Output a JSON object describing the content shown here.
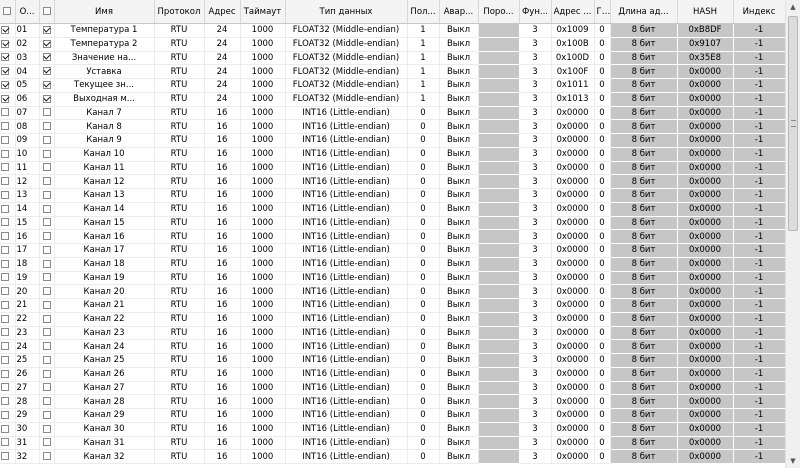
{
  "header": {
    "check_label": "",
    "number": "О...",
    "enabled": "",
    "name": "Имя",
    "protocol": "Протокол",
    "address": "Адрес",
    "timeout": "Таймаут",
    "datatype": "Тип данных",
    "pol": "Пол...",
    "alarm": "Авар...",
    "threshold": "Поро...",
    "func": "Фун...",
    "regaddr": "Адрес ...",
    "g": "Г...",
    "len": "Длина ад...",
    "hash": "HASH",
    "index": "Индекс"
  },
  "rows": [
    {
      "c1": true,
      "num": "01",
      "c2": true,
      "name": "Температура 1",
      "protocol": "RTU",
      "address": "24",
      "timeout": "1000",
      "datatype": "FLOAT32 (Middle-endian)",
      "pol": "1",
      "alarm": "Выкл",
      "func": "3",
      "regaddr": "0x1009",
      "g": "0",
      "len": "8 бит",
      "hash": "0xB8DF",
      "index": "-1"
    },
    {
      "c1": true,
      "num": "02",
      "c2": true,
      "name": "Температура 2",
      "protocol": "RTU",
      "address": "24",
      "timeout": "1000",
      "datatype": "FLOAT32 (Middle-endian)",
      "pol": "1",
      "alarm": "Выкл",
      "func": "3",
      "regaddr": "0x100B",
      "g": "0",
      "len": "8 бит",
      "hash": "0x9107",
      "index": "-1"
    },
    {
      "c1": true,
      "num": "03",
      "c2": true,
      "name": "Значение на...",
      "protocol": "RTU",
      "address": "24",
      "timeout": "1000",
      "datatype": "FLOAT32 (Middle-endian)",
      "pol": "1",
      "alarm": "Выкл",
      "func": "3",
      "regaddr": "0x100D",
      "g": "0",
      "len": "8 бит",
      "hash": "0x35E8",
      "index": "-1"
    },
    {
      "c1": true,
      "num": "04",
      "c2": true,
      "name": "Уставка",
      "protocol": "RTU",
      "address": "24",
      "timeout": "1000",
      "datatype": "FLOAT32 (Middle-endian)",
      "pol": "1",
      "alarm": "Выкл",
      "func": "3",
      "regaddr": "0x100F",
      "g": "0",
      "len": "8 бит",
      "hash": "0x0000",
      "index": "-1"
    },
    {
      "c1": true,
      "num": "05",
      "c2": true,
      "name": "Текущее зн...",
      "protocol": "RTU",
      "address": "24",
      "timeout": "1000",
      "datatype": "FLOAT32 (Middle-endian)",
      "pol": "1",
      "alarm": "Выкл",
      "func": "3",
      "regaddr": "0x1011",
      "g": "0",
      "len": "8 бит",
      "hash": "0x0000",
      "index": "-1"
    },
    {
      "c1": true,
      "num": "06",
      "c2": true,
      "name": "Выходная м...",
      "protocol": "RTU",
      "address": "24",
      "timeout": "1000",
      "datatype": "FLOAT32 (Middle-endian)",
      "pol": "1",
      "alarm": "Выкл",
      "func": "3",
      "regaddr": "0x1013",
      "g": "0",
      "len": "8 бит",
      "hash": "0x0000",
      "index": "-1"
    },
    {
      "c1": false,
      "num": "07",
      "c2": false,
      "name": "Канал 7",
      "protocol": "RTU",
      "address": "16",
      "timeout": "1000",
      "datatype": "INT16 (Little-endian)",
      "pol": "0",
      "alarm": "Выкл",
      "func": "3",
      "regaddr": "0x0000",
      "g": "0",
      "len": "8 бит",
      "hash": "0x0000",
      "index": "-1"
    },
    {
      "c1": false,
      "num": "08",
      "c2": false,
      "name": "Канал 8",
      "protocol": "RTU",
      "address": "16",
      "timeout": "1000",
      "datatype": "INT16 (Little-endian)",
      "pol": "0",
      "alarm": "Выкл",
      "func": "3",
      "regaddr": "0x0000",
      "g": "0",
      "len": "8 бит",
      "hash": "0x0000",
      "index": "-1"
    },
    {
      "c1": false,
      "num": "09",
      "c2": false,
      "name": "Канал 9",
      "protocol": "RTU",
      "address": "16",
      "timeout": "1000",
      "datatype": "INT16 (Little-endian)",
      "pol": "0",
      "alarm": "Выкл",
      "func": "3",
      "regaddr": "0x0000",
      "g": "0",
      "len": "8 бит",
      "hash": "0x0000",
      "index": "-1"
    },
    {
      "c1": false,
      "num": "10",
      "c2": false,
      "name": "Канал 10",
      "protocol": "RTU",
      "address": "16",
      "timeout": "1000",
      "datatype": "INT16 (Little-endian)",
      "pol": "0",
      "alarm": "Выкл",
      "func": "3",
      "regaddr": "0x0000",
      "g": "0",
      "len": "8 бит",
      "hash": "0x0000",
      "index": "-1"
    },
    {
      "c1": false,
      "num": "11",
      "c2": false,
      "name": "Канал 11",
      "protocol": "RTU",
      "address": "16",
      "timeout": "1000",
      "datatype": "INT16 (Little-endian)",
      "pol": "0",
      "alarm": "Выкл",
      "func": "3",
      "regaddr": "0x0000",
      "g": "0",
      "len": "8 бит",
      "hash": "0x0000",
      "index": "-1"
    },
    {
      "c1": false,
      "num": "12",
      "c2": false,
      "name": "Канал 12",
      "protocol": "RTU",
      "address": "16",
      "timeout": "1000",
      "datatype": "INT16 (Little-endian)",
      "pol": "0",
      "alarm": "Выкл",
      "func": "3",
      "regaddr": "0x0000",
      "g": "0",
      "len": "8 бит",
      "hash": "0x0000",
      "index": "-1"
    },
    {
      "c1": false,
      "num": "13",
      "c2": false,
      "name": "Канал 13",
      "protocol": "RTU",
      "address": "16",
      "timeout": "1000",
      "datatype": "INT16 (Little-endian)",
      "pol": "0",
      "alarm": "Выкл",
      "func": "3",
      "regaddr": "0x0000",
      "g": "0",
      "len": "8 бит",
      "hash": "0x0000",
      "index": "-1"
    },
    {
      "c1": false,
      "num": "14",
      "c2": false,
      "name": "Канал 14",
      "protocol": "RTU",
      "address": "16",
      "timeout": "1000",
      "datatype": "INT16 (Little-endian)",
      "pol": "0",
      "alarm": "Выкл",
      "func": "3",
      "regaddr": "0x0000",
      "g": "0",
      "len": "8 бит",
      "hash": "0x0000",
      "index": "-1"
    },
    {
      "c1": false,
      "num": "15",
      "c2": false,
      "name": "Канал 15",
      "protocol": "RTU",
      "address": "16",
      "timeout": "1000",
      "datatype": "INT16 (Little-endian)",
      "pol": "0",
      "alarm": "Выкл",
      "func": "3",
      "regaddr": "0x0000",
      "g": "0",
      "len": "8 бит",
      "hash": "0x0000",
      "index": "-1"
    },
    {
      "c1": false,
      "num": "16",
      "c2": false,
      "name": "Канал 16",
      "protocol": "RTU",
      "address": "16",
      "timeout": "1000",
      "datatype": "INT16 (Little-endian)",
      "pol": "0",
      "alarm": "Выкл",
      "func": "3",
      "regaddr": "0x0000",
      "g": "0",
      "len": "8 бит",
      "hash": "0x0000",
      "index": "-1"
    },
    {
      "c1": false,
      "num": "17",
      "c2": false,
      "name": "Канал 17",
      "protocol": "RTU",
      "address": "16",
      "timeout": "1000",
      "datatype": "INT16 (Little-endian)",
      "pol": "0",
      "alarm": "Выкл",
      "func": "3",
      "regaddr": "0x0000",
      "g": "0",
      "len": "8 бит",
      "hash": "0x0000",
      "index": "-1"
    },
    {
      "c1": false,
      "num": "18",
      "c2": false,
      "name": "Канал 18",
      "protocol": "RTU",
      "address": "16",
      "timeout": "1000",
      "datatype": "INT16 (Little-endian)",
      "pol": "0",
      "alarm": "Выкл",
      "func": "3",
      "regaddr": "0x0000",
      "g": "0",
      "len": "8 бит",
      "hash": "0x0000",
      "index": "-1"
    },
    {
      "c1": false,
      "num": "19",
      "c2": false,
      "name": "Канал 19",
      "protocol": "RTU",
      "address": "16",
      "timeout": "1000",
      "datatype": "INT16 (Little-endian)",
      "pol": "0",
      "alarm": "Выкл",
      "func": "3",
      "regaddr": "0x0000",
      "g": "0",
      "len": "8 бит",
      "hash": "0x0000",
      "index": "-1"
    },
    {
      "c1": false,
      "num": "20",
      "c2": false,
      "name": "Канал 20",
      "protocol": "RTU",
      "address": "16",
      "timeout": "1000",
      "datatype": "INT16 (Little-endian)",
      "pol": "0",
      "alarm": "Выкл",
      "func": "3",
      "regaddr": "0x0000",
      "g": "0",
      "len": "8 бит",
      "hash": "0x0000",
      "index": "-1"
    },
    {
      "c1": false,
      "num": "21",
      "c2": false,
      "name": "Канал 21",
      "protocol": "RTU",
      "address": "16",
      "timeout": "1000",
      "datatype": "INT16 (Little-endian)",
      "pol": "0",
      "alarm": "Выкл",
      "func": "3",
      "regaddr": "0x0000",
      "g": "0",
      "len": "8 бит",
      "hash": "0x0000",
      "index": "-1"
    },
    {
      "c1": false,
      "num": "22",
      "c2": false,
      "name": "Канал 22",
      "protocol": "RTU",
      "address": "16",
      "timeout": "1000",
      "datatype": "INT16 (Little-endian)",
      "pol": "0",
      "alarm": "Выкл",
      "func": "3",
      "regaddr": "0x0000",
      "g": "0",
      "len": "8 бит",
      "hash": "0x0000",
      "index": "-1"
    },
    {
      "c1": false,
      "num": "23",
      "c2": false,
      "name": "Канал 23",
      "protocol": "RTU",
      "address": "16",
      "timeout": "1000",
      "datatype": "INT16 (Little-endian)",
      "pol": "0",
      "alarm": "Выкл",
      "func": "3",
      "regaddr": "0x0000",
      "g": "0",
      "len": "8 бит",
      "hash": "0x0000",
      "index": "-1"
    },
    {
      "c1": false,
      "num": "24",
      "c2": false,
      "name": "Канал 24",
      "protocol": "RTU",
      "address": "16",
      "timeout": "1000",
      "datatype": "INT16 (Little-endian)",
      "pol": "0",
      "alarm": "Выкл",
      "func": "3",
      "regaddr": "0x0000",
      "g": "0",
      "len": "8 бит",
      "hash": "0x0000",
      "index": "-1"
    },
    {
      "c1": false,
      "num": "25",
      "c2": false,
      "name": "Канал 25",
      "protocol": "RTU",
      "address": "16",
      "timeout": "1000",
      "datatype": "INT16 (Little-endian)",
      "pol": "0",
      "alarm": "Выкл",
      "func": "3",
      "regaddr": "0x0000",
      "g": "0",
      "len": "8 бит",
      "hash": "0x0000",
      "index": "-1"
    },
    {
      "c1": false,
      "num": "26",
      "c2": false,
      "name": "Канал 26",
      "protocol": "RTU",
      "address": "16",
      "timeout": "1000",
      "datatype": "INT16 (Little-endian)",
      "pol": "0",
      "alarm": "Выкл",
      "func": "3",
      "regaddr": "0x0000",
      "g": "0",
      "len": "8 бит",
      "hash": "0x0000",
      "index": "-1"
    },
    {
      "c1": false,
      "num": "27",
      "c2": false,
      "name": "Канал 27",
      "protocol": "RTU",
      "address": "16",
      "timeout": "1000",
      "datatype": "INT16 (Little-endian)",
      "pol": "0",
      "alarm": "Выкл",
      "func": "3",
      "regaddr": "0x0000",
      "g": "0",
      "len": "8 бит",
      "hash": "0x0000",
      "index": "-1"
    },
    {
      "c1": false,
      "num": "28",
      "c2": false,
      "name": "Канал 28",
      "protocol": "RTU",
      "address": "16",
      "timeout": "1000",
      "datatype": "INT16 (Little-endian)",
      "pol": "0",
      "alarm": "Выкл",
      "func": "3",
      "regaddr": "0x0000",
      "g": "0",
      "len": "8 бит",
      "hash": "0x0000",
      "index": "-1"
    },
    {
      "c1": false,
      "num": "29",
      "c2": false,
      "name": "Канал 29",
      "protocol": "RTU",
      "address": "16",
      "timeout": "1000",
      "datatype": "INT16 (Little-endian)",
      "pol": "0",
      "alarm": "Выкл",
      "func": "3",
      "regaddr": "0x0000",
      "g": "0",
      "len": "8 бит",
      "hash": "0x0000",
      "index": "-1"
    },
    {
      "c1": false,
      "num": "30",
      "c2": false,
      "name": "Канал 30",
      "protocol": "RTU",
      "address": "16",
      "timeout": "1000",
      "datatype": "INT16 (Little-endian)",
      "pol": "0",
      "alarm": "Выкл",
      "func": "3",
      "regaddr": "0x0000",
      "g": "0",
      "len": "8 бит",
      "hash": "0x0000",
      "index": "-1"
    },
    {
      "c1": false,
      "num": "31",
      "c2": false,
      "name": "Канал 31",
      "protocol": "RTU",
      "address": "16",
      "timeout": "1000",
      "datatype": "INT16 (Little-endian)",
      "pol": "0",
      "alarm": "Выкл",
      "func": "3",
      "regaddr": "0x0000",
      "g": "0",
      "len": "8 бит",
      "hash": "0x0000",
      "index": "-1"
    },
    {
      "c1": false,
      "num": "32",
      "c2": false,
      "name": "Канал 32",
      "protocol": "RTU",
      "address": "16",
      "timeout": "1000",
      "datatype": "INT16 (Little-endian)",
      "pol": "0",
      "alarm": "Выкл",
      "func": "3",
      "regaddr": "0x0000",
      "g": "0",
      "len": "8 бит",
      "hash": "0x0000",
      "index": "-1"
    }
  ],
  "scrollbar": {
    "up_arrow": "up-arrow-icon",
    "down_arrow": "down-arrow-icon"
  }
}
